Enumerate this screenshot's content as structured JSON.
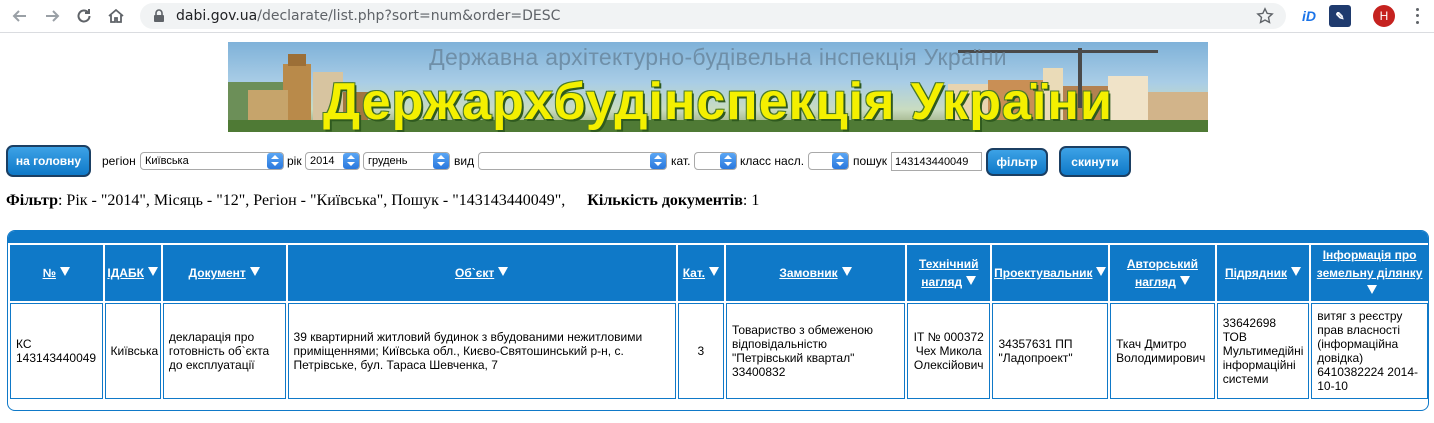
{
  "browser": {
    "url_host": "dabi.gov.ua",
    "url_path": "/declarate/list.php?sort=num&order=DESC",
    "avatar_letter": "H",
    "ext_id_label": "iD"
  },
  "banner": {
    "subtitle": "Державна архітектурно-будівельна інспекція України",
    "title": "Держархбудінспекція України"
  },
  "filters": {
    "home_button": "на головну",
    "region_label": "регіон",
    "region_value": "Київська",
    "year_label": "рік",
    "year_value": "2014",
    "month_value": "грудень",
    "type_label": "вид",
    "type_value": "",
    "cat_label": "кат.",
    "cat_value": "",
    "class_label": "класс насл.",
    "class_value": "",
    "search_label": "пошук",
    "search_value": "143143440049",
    "filter_button": "фільтр",
    "reset_button": "скинути"
  },
  "summary": {
    "filter_label": "Фільтр",
    "filter_text": ": Рік - \"2014\", Місяць - \"12\", Регіон - \"Київська\", Пошук - \"143143440049\",",
    "count_label": "Кількість документів",
    "count_text": ": 1"
  },
  "table": {
    "headers": [
      "№",
      "ІДАБК",
      "Документ",
      "Об`єкт",
      "Кат.",
      "Замовник",
      "Технічний нагляд",
      "Проектувальник",
      "Авторський нагляд",
      "Підрядник",
      "Інформація про земельну ділянку"
    ],
    "rows": [
      {
        "num": "КС 143143440049",
        "idabk": "Київська",
        "document": "декларація про готовність об`єкта до експлуатації",
        "object": "39 квартирний житловий будинок з вбудованими нежитловими приміщеннями; Київська обл., Києво-Святошинський р-н, с. Петрівське, бул. Тараса Шевченка, 7",
        "cat": "3",
        "customer": "Товариство з обмеженою відповідальністю \"Петрівський квартал\" 33400832",
        "tech_supervision": "ІТ № 000372 Чех Микола Олексійович",
        "designer": "34357631 ПП \"Ладопроект\"",
        "author_supervision": "Ткач Дмитро Володимирович",
        "contractor": "33642698 ТОВ Мультимедійні інформаційні системи",
        "land_info": "витяг з реєстру прав власності (інформаційна довідка) 6410382224 2014-10-10"
      }
    ]
  }
}
